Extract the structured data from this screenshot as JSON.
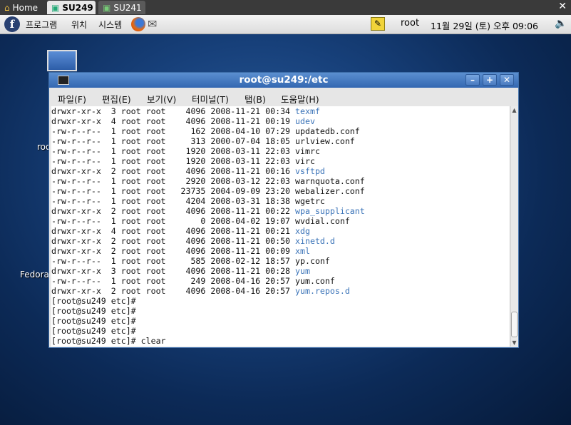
{
  "tabs": [
    {
      "label": "Home",
      "icon": "home-icon"
    },
    {
      "label": "SU249",
      "icon": "remote-desktop-icon"
    },
    {
      "label": "SU241",
      "icon": "remote-desktop-icon"
    }
  ],
  "tab_close": "✕",
  "panel": {
    "logo": "f",
    "menus": [
      "프로그램",
      "위치",
      "시스템"
    ],
    "user": "root",
    "clock": "11월 29일 (토) 오후 09:06"
  },
  "desktop_labels": [
    "roo",
    "Fedora"
  ],
  "window": {
    "title": "root@su249:/etc",
    "buttons": {
      "minimize": "–",
      "maximize": "+",
      "close": "✕"
    },
    "menu": [
      "파일(F)",
      "편집(E)",
      "보기(V)",
      "터미널(T)",
      "탭(B)",
      "도움말(H)"
    ]
  },
  "terminal": {
    "rows": [
      {
        "prefix": "drwxr-xr-x  3 root root    4096 2008-11-21 00:34 ",
        "name": "texmf",
        "dir": true
      },
      {
        "prefix": "drwxr-xr-x  4 root root    4096 2008-11-21 00:19 ",
        "name": "udev",
        "dir": true
      },
      {
        "prefix": "-rw-r--r--  1 root root     162 2008-04-10 07:29 ",
        "name": "updatedb.conf",
        "dir": false
      },
      {
        "prefix": "-rw-r--r--  1 root root     313 2000-07-04 18:05 ",
        "name": "urlview.conf",
        "dir": false
      },
      {
        "prefix": "-rw-r--r--  1 root root    1920 2008-03-11 22:03 ",
        "name": "vimrc",
        "dir": false
      },
      {
        "prefix": "-rw-r--r--  1 root root    1920 2008-03-11 22:03 ",
        "name": "virc",
        "dir": false
      },
      {
        "prefix": "drwxr-xr-x  2 root root    4096 2008-11-21 00:16 ",
        "name": "vsftpd",
        "dir": true
      },
      {
        "prefix": "-rw-r--r--  1 root root    2920 2008-03-12 22:03 ",
        "name": "warnquota.conf",
        "dir": false
      },
      {
        "prefix": "-rw-r--r--  1 root root   23735 2004-09-09 23:20 ",
        "name": "webalizer.conf",
        "dir": false
      },
      {
        "prefix": "-rw-r--r--  1 root root    4204 2008-03-31 18:38 ",
        "name": "wgetrc",
        "dir": false
      },
      {
        "prefix": "drwxr-xr-x  2 root root    4096 2008-11-21 00:22 ",
        "name": "wpa_supplicant",
        "dir": true
      },
      {
        "prefix": "-rw-r--r--  1 root root       0 2008-04-02 19:07 ",
        "name": "wvdial.conf",
        "dir": false
      },
      {
        "prefix": "drwxr-xr-x  4 root root    4096 2008-11-21 00:21 ",
        "name": "xdg",
        "dir": true
      },
      {
        "prefix": "drwxr-xr-x  2 root root    4096 2008-11-21 00:50 ",
        "name": "xinetd.d",
        "dir": true
      },
      {
        "prefix": "drwxr-xr-x  2 root root    4096 2008-11-21 00:09 ",
        "name": "xml",
        "dir": true
      },
      {
        "prefix": "-rw-r--r--  1 root root     585 2008-02-12 18:57 ",
        "name": "yp.conf",
        "dir": false
      },
      {
        "prefix": "drwxr-xr-x  3 root root    4096 2008-11-21 00:28 ",
        "name": "yum",
        "dir": true
      },
      {
        "prefix": "-rw-r--r--  1 root root     249 2008-04-16 20:57 ",
        "name": "yum.conf",
        "dir": false
      },
      {
        "prefix": "drwxr-xr-x  2 root root    4096 2008-04-16 20:57 ",
        "name": "yum.repos.d",
        "dir": true
      }
    ],
    "prompts": [
      "[root@su249 etc]#",
      "[root@su249 etc]#",
      "[root@su249 etc]#",
      "[root@su249 etc]#",
      "[root@su249 etc]# clear"
    ],
    "dir_color": "#3a73b8"
  }
}
